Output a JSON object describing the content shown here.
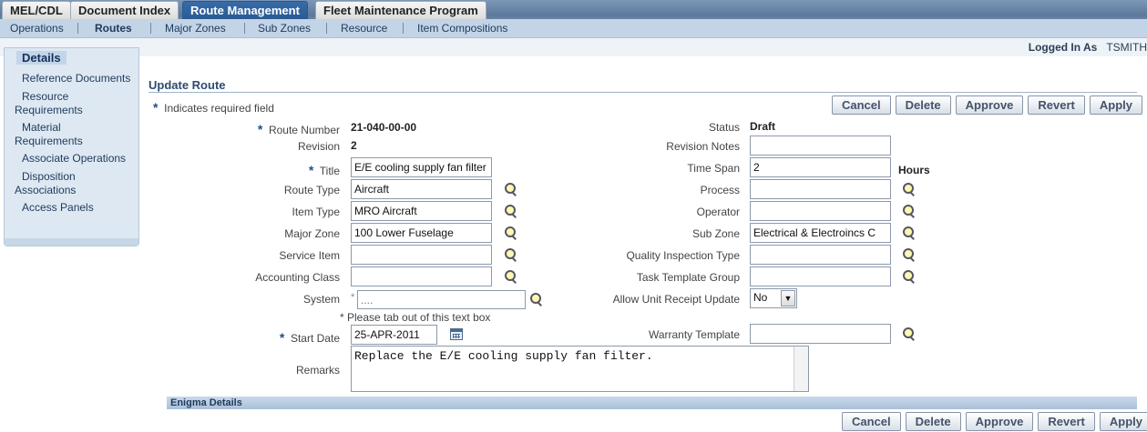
{
  "tabs": [
    {
      "label": "MEL/CDL"
    },
    {
      "label": "Document Index"
    },
    {
      "label": "Route Management"
    },
    {
      "label": "Fleet Maintenance Program"
    }
  ],
  "subnav": [
    {
      "label": "Operations"
    },
    {
      "label": "Routes"
    },
    {
      "label": "Major Zones"
    },
    {
      "label": "Sub Zones"
    },
    {
      "label": "Resource"
    },
    {
      "label": "Item Compositions"
    }
  ],
  "user": {
    "logged_in_label": "Logged In As",
    "name": "TSMITH"
  },
  "sidebar": {
    "items": [
      {
        "label": "Details"
      },
      {
        "label": "Reference Documents"
      },
      {
        "label": "Resource"
      },
      {
        "label": "Requirements"
      },
      {
        "label": "Material"
      },
      {
        "label": "Requirements"
      },
      {
        "label": "Associate Operations"
      },
      {
        "label": "Disposition"
      },
      {
        "label": "Associations"
      },
      {
        "label": "Access Panels"
      }
    ]
  },
  "page": {
    "title": "Update Route",
    "required_note": "Indicates required field",
    "star": "*"
  },
  "buttons": {
    "cancel": "Cancel",
    "delete": "Delete",
    "approve": "Approve",
    "revert": "Revert",
    "apply": "Apply"
  },
  "form": {
    "route_number": {
      "label": "Route Number",
      "value": "21-040-00-00"
    },
    "revision": {
      "label": "Revision",
      "value": "2"
    },
    "title": {
      "label": "Title",
      "value": "E/E cooling supply fan filter"
    },
    "route_type": {
      "label": "Route Type",
      "value": "Aircraft"
    },
    "item_type": {
      "label": "Item Type",
      "value": "MRO Aircraft"
    },
    "major_zone": {
      "label": "Major Zone",
      "value": "100 Lower Fuselage"
    },
    "service_item": {
      "label": "Service Item",
      "value": ""
    },
    "accounting_class": {
      "label": "Accounting Class",
      "value": ""
    },
    "system": {
      "label": "System",
      "placeholder": "....",
      "hint": "* Please tab out of this text box"
    },
    "start_date": {
      "label": "Start Date",
      "value": "25-APR-2011"
    },
    "remarks": {
      "label": "Remarks",
      "value": "Replace the E/E cooling supply fan filter."
    },
    "status": {
      "label": "Status",
      "value": "Draft"
    },
    "revision_notes": {
      "label": "Revision Notes",
      "value": ""
    },
    "time_span": {
      "label": "Time Span",
      "value": "2",
      "unit": "Hours"
    },
    "process": {
      "label": "Process",
      "value": ""
    },
    "operator": {
      "label": "Operator",
      "value": ""
    },
    "sub_zone": {
      "label": "Sub Zone",
      "value": "Electrical & Electroincs C"
    },
    "quality_inspection_type": {
      "label": "Quality Inspection Type",
      "value": ""
    },
    "task_template_group": {
      "label": "Task Template Group",
      "value": ""
    },
    "allow_unit_receipt_update": {
      "label": "Allow Unit Receipt Update",
      "value": "No"
    },
    "warranty_template": {
      "label": "Warranty Template",
      "value": ""
    }
  },
  "section": {
    "enigma": "Enigma Details"
  },
  "icons": {
    "lookup": "magnifier-icon",
    "calendar": "calendar-icon",
    "select_arrow": "chevron-down-icon"
  }
}
